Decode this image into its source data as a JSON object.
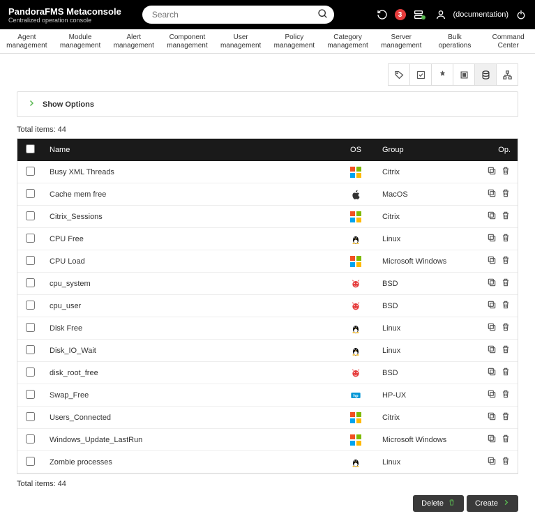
{
  "brand": {
    "title": "PandoraFMS Metaconsole",
    "subtitle": "Centralized operation console"
  },
  "search": {
    "placeholder": "Search"
  },
  "badges": {
    "alerts": "3"
  },
  "user": {
    "name": "(documentation)"
  },
  "nav": {
    "items": [
      {
        "line1": "Agent",
        "line2": "management"
      },
      {
        "line1": "Module",
        "line2": "management"
      },
      {
        "line1": "Alert",
        "line2": "management"
      },
      {
        "line1": "Component",
        "line2": "management"
      },
      {
        "line1": "User",
        "line2": "management"
      },
      {
        "line1": "Policy",
        "line2": "management"
      },
      {
        "line1": "Category",
        "line2": "management"
      },
      {
        "line1": "Server",
        "line2": "management"
      },
      {
        "line1": "Bulk",
        "line2": "operations"
      },
      {
        "line1": "Command",
        "line2": "Center"
      }
    ]
  },
  "options_bar": {
    "label": "Show Options"
  },
  "totals": {
    "top": "Total items: 44",
    "bottom": "Total items: 44"
  },
  "table": {
    "headers": {
      "name": "Name",
      "os": "OS",
      "group": "Group",
      "op": "Op."
    },
    "rows": [
      {
        "name": "Busy XML Threads",
        "os": "windows",
        "group": "Citrix"
      },
      {
        "name": "Cache mem free",
        "os": "apple",
        "group": "MacOS"
      },
      {
        "name": "Citrix_Sessions",
        "os": "windows",
        "group": "Citrix"
      },
      {
        "name": "CPU Free",
        "os": "linux",
        "group": "Linux"
      },
      {
        "name": "CPU Load",
        "os": "windows",
        "group": "Microsoft Windows"
      },
      {
        "name": "cpu_system",
        "os": "bsd",
        "group": "BSD"
      },
      {
        "name": "cpu_user",
        "os": "bsd",
        "group": "BSD"
      },
      {
        "name": "Disk Free",
        "os": "linux",
        "group": "Linux"
      },
      {
        "name": "Disk_IO_Wait",
        "os": "linux",
        "group": "Linux"
      },
      {
        "name": "disk_root_free",
        "os": "bsd",
        "group": "BSD"
      },
      {
        "name": "Swap_Free",
        "os": "hpux",
        "group": "HP-UX"
      },
      {
        "name": "Users_Connected",
        "os": "windows",
        "group": "Citrix"
      },
      {
        "name": "Windows_Update_LastRun",
        "os": "windows",
        "group": "Microsoft Windows"
      },
      {
        "name": "Zombie processes",
        "os": "linux",
        "group": "Linux"
      }
    ]
  },
  "footer": {
    "delete": "Delete",
    "create": "Create"
  }
}
